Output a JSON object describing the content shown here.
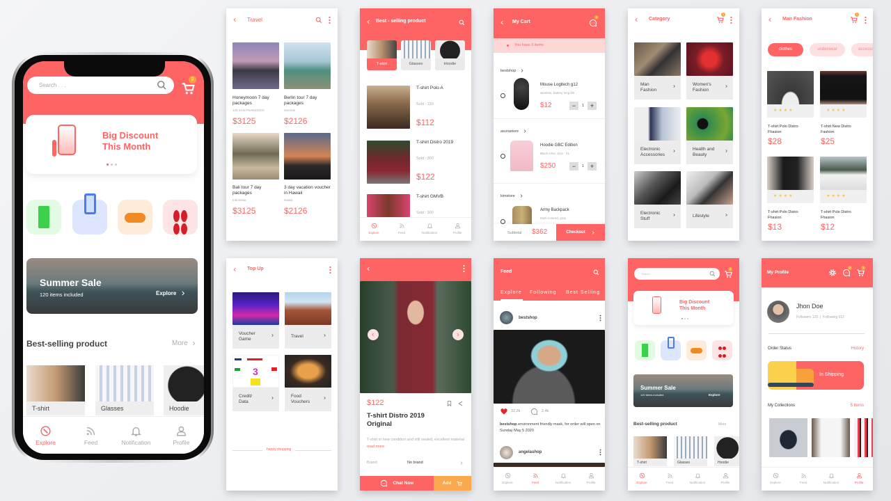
{
  "colors": {
    "accent": "#FE6464",
    "badge": "#F7A33B",
    "add_button": "#FBA94E"
  },
  "nav": [
    "Explore",
    "Feed",
    "Notification",
    "Profile"
  ],
  "home": {
    "search_placeholder": "Search . . .",
    "search_placeholder_small": "Search . . .",
    "cart_badge": "3",
    "banner_line1": "Big Discount",
    "banner_line2": "This Month",
    "quick_icons": [
      "coupon-icon",
      "phone-topup-icon",
      "gamepad-icon",
      "more-categories-icon"
    ],
    "promo": {
      "title": "Summer Sale",
      "subtitle": "120 items included",
      "action": "Explore"
    },
    "section_title": "Best-selling product",
    "more": "More",
    "products": [
      "T-shirt",
      "Glasses",
      "Hoodie"
    ]
  },
  "travel": {
    "title": "Travel",
    "items": [
      {
        "name": "Honeymoon 7 day packages",
        "sub": "125 SAN FRANSISCO",
        "price": "$3125"
      },
      {
        "name": "Berlin tour 7 day packages",
        "sub": "German",
        "price": "$2126"
      },
      {
        "name": "Bali tour 7 day packages",
        "sub": "Indonesia",
        "price": "$3125"
      },
      {
        "name": "3 day vacation voucher in Hawaii",
        "sub": "Hawai",
        "price": "$2126"
      }
    ]
  },
  "bestselling": {
    "title": "Best - selling product",
    "tabs": [
      "T-shirt",
      "Glasses",
      "Hoodie"
    ],
    "items": [
      {
        "name": "T-shirt Polo A",
        "sold": "Sold : 120",
        "price": "$112"
      },
      {
        "name": "T-shirt Distro 2019",
        "sold": "Sold : 300",
        "price": "$122"
      },
      {
        "name": "T-shirt GMVB",
        "sold": "Sold : 300"
      }
    ]
  },
  "cart": {
    "title": "My Cart",
    "badge": "3",
    "notice": "You have 3 items",
    "stores": [
      {
        "store": "bestshop",
        "item": "Mouse Logitech g12",
        "desc": "wireless, battery long life",
        "price": "$12",
        "qty": "1"
      },
      {
        "store": "asurastore",
        "item": "Hoodie GBC Edition",
        "desc": "Black color, Size : XL",
        "price": "$250",
        "qty": "1"
      },
      {
        "store": "kimstore",
        "item": "Army Backpack",
        "desc": "Multi-colored, gray"
      }
    ],
    "subtotal_label": "Subtotal",
    "subtotal": "$362",
    "checkout": "Checkout"
  },
  "category": {
    "title": "Category",
    "cart_badge": "3",
    "tiles": [
      "Man Fashion",
      "Women's Fashion",
      "Electronic Accessories",
      "Health and Beauty",
      "Electronic Stuff",
      "Lifestyle"
    ]
  },
  "man_fashion": {
    "title": "Man Fashion",
    "cart_badge": "3",
    "chips": [
      "clothes",
      "underwear",
      "accessories"
    ],
    "items": [
      {
        "name": "T-shirt Polo Distro Fhasion",
        "price": "$28",
        "rating": 4
      },
      {
        "name": "T-shirt New Distro Fashion",
        "price": "$25",
        "rating": 4
      },
      {
        "name": "T-shirt Polo Distro Fhasion",
        "price": "$13",
        "rating": 4
      },
      {
        "name": "T-shirt Polo Distro Fhasion",
        "price": "$12",
        "rating": 4
      }
    ]
  },
  "topup": {
    "title": "Top Up",
    "tiles": [
      "Voucher Game",
      "Travel",
      "Credit/ Data",
      "Food Vouchers"
    ],
    "footer": "happy shopping"
  },
  "product": {
    "price": "$122",
    "title": "T-shirt Distro 2019 Original",
    "desc": "T-shirt in new condition and still sealed, excellent material",
    "read_more": "read more",
    "brand_label": "Brand",
    "brand": "No brand",
    "chat": "Chat Now",
    "add": "Add"
  },
  "feed": {
    "title": "Feed",
    "tabs": [
      "Explore",
      "Following",
      "Best Selling"
    ],
    "posts": [
      {
        "user": "bestshop",
        "likes": "32,2k",
        "comments": "2,4k",
        "caption_user": "bestshop",
        "caption": "environment friendly mask, for order will open on Sunday May 5 2020"
      },
      {
        "user": "angelashop"
      }
    ]
  },
  "profile": {
    "title": "My Profile",
    "chat_badge": "3",
    "cart_badge": "3",
    "name": "Jhon Doe",
    "followers": "Followers 125",
    "following": "Following 612",
    "order_status": "Order Status",
    "history": "History",
    "shipping": "In Shipping",
    "collections": "My Collections",
    "collections_count": "5 items"
  }
}
